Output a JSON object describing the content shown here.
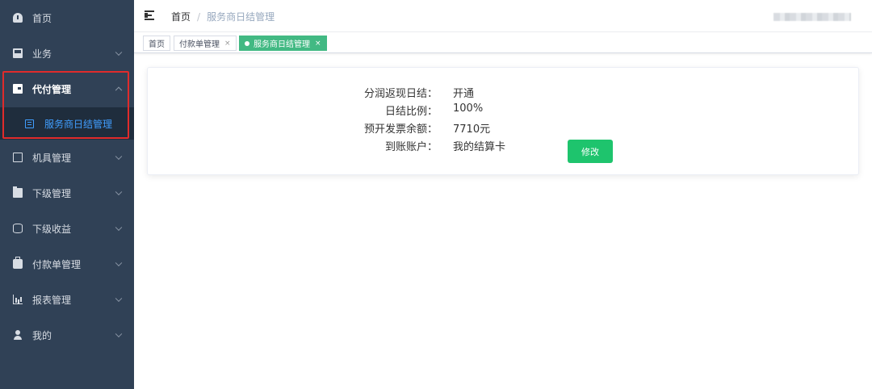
{
  "sidebar": {
    "items": [
      {
        "label": "首页",
        "icon": "dashboard-icon",
        "has_arrow": false
      },
      {
        "label": "业务",
        "icon": "briefcase-icon",
        "has_arrow": true
      },
      {
        "label": "代付管理",
        "icon": "wallet-icon",
        "has_arrow": true,
        "expanded": true
      },
      {
        "label": "机具管理",
        "icon": "device-icon",
        "has_arrow": true
      },
      {
        "label": "下级管理",
        "icon": "folder-icon",
        "has_arrow": true
      },
      {
        "label": "下级收益",
        "icon": "database-icon",
        "has_arrow": true
      },
      {
        "label": "付款单管理",
        "icon": "bag-icon",
        "has_arrow": true
      },
      {
        "label": "报表管理",
        "icon": "chart-icon",
        "has_arrow": true
      },
      {
        "label": "我的",
        "icon": "user-icon",
        "has_arrow": true
      }
    ],
    "submenu": {
      "label": "服务商日结管理",
      "icon": "list-icon",
      "active": true
    },
    "colors": {
      "bg": "#304156",
      "sub_bg": "#1f2d3d",
      "active": "#409eff",
      "highlight": "#e02b2b"
    }
  },
  "navbar": {
    "breadcrumb": {
      "home": "首页",
      "separator": "/",
      "current": "服务商日结管理"
    }
  },
  "tags": [
    {
      "label": "首页",
      "closable": false,
      "active": false
    },
    {
      "label": "付款单管理",
      "closable": true,
      "active": false
    },
    {
      "label": "服务商日结管理",
      "closable": true,
      "active": true
    }
  ],
  "tag_close_symbol": "×",
  "settlement": {
    "rows": [
      {
        "label": "分润返现日结：",
        "value": "开通"
      },
      {
        "label": "日结比例：",
        "value": "100%"
      },
      {
        "label": "预开发票余额：",
        "value": "7710元"
      },
      {
        "label": "到账账户：",
        "value": "我的结算卡"
      }
    ],
    "edit_button": "修改",
    "button_color": "#1ec46d"
  }
}
